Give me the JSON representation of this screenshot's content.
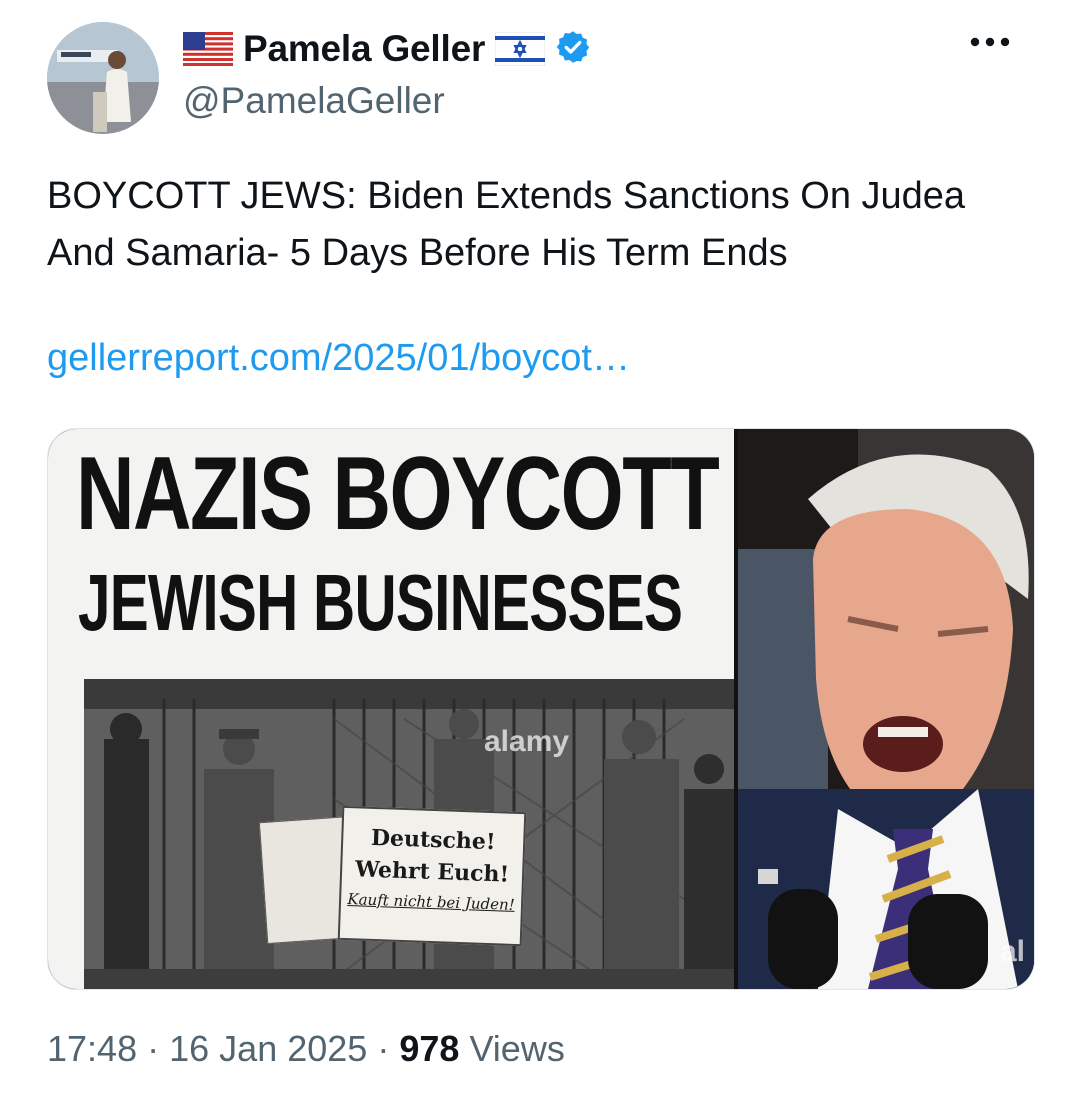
{
  "author": {
    "display_name": "Pamela Geller",
    "handle": "@PamelaGeller",
    "verified": true,
    "flags": [
      "us-flag",
      "israel-flag"
    ]
  },
  "tweet": {
    "text": "BOYCOTT JEWS: Biden Extends Sanctions On Judea And Samaria- 5 Days Before His Term Ends",
    "link_text": "gellerreport.com/2025/01/boycot…"
  },
  "media": {
    "left_image": {
      "headline_1": "NAZIS BOYCOTT",
      "headline_2": "JEWISH BUSINESSES",
      "sign_line_1": "Deutsche!",
      "sign_line_2": "Wehrt Euch!",
      "sign_line_3": "Kauft nicht bei Juden!",
      "watermark": "alamy"
    },
    "right_image": {
      "watermark": "al"
    }
  },
  "footer": {
    "time": "17:48",
    "separator": "·",
    "date": "16 Jan 2025",
    "views_count": "978",
    "views_label": "Views"
  },
  "colors": {
    "link": "#1d9bf0",
    "secondary_text": "#536471",
    "verified": "#1d9bf0"
  }
}
